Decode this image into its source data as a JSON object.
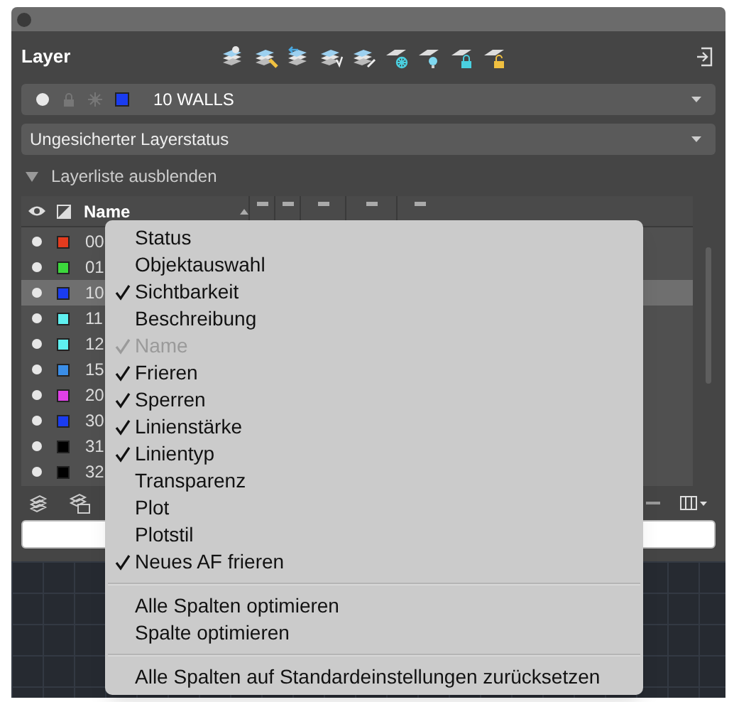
{
  "panel": {
    "title": "Layer"
  },
  "current_layer": {
    "label": "10 WALLS",
    "color": "#1a3cf0"
  },
  "layer_state": {
    "label": "Ungesicherter Layerstatus"
  },
  "collapse_toggle": {
    "label": "Layerliste ausblenden",
    "expanded": true
  },
  "table": {
    "columns": [
      {
        "label": "Name"
      }
    ],
    "rows": [
      {
        "name": "00",
        "color": "#e33b1e",
        "selected": false
      },
      {
        "name": "01",
        "color": "#3cd83c",
        "selected": false
      },
      {
        "name": "10",
        "color": "#1a3cf0",
        "selected": true
      },
      {
        "name": "11",
        "color": "#5ff0f0",
        "selected": false
      },
      {
        "name": "12",
        "color": "#5ff0f0",
        "selected": false
      },
      {
        "name": "15",
        "color": "#3a8ee8",
        "selected": false
      },
      {
        "name": "20",
        "color": "#e040e8",
        "selected": false
      },
      {
        "name": "30",
        "color": "#1a3cf0",
        "selected": false
      },
      {
        "name": "31",
        "color": "#000000",
        "selected": false
      },
      {
        "name": "32",
        "color": "#000000",
        "selected": false
      }
    ]
  },
  "context_menu": {
    "groups": [
      [
        {
          "label": "Status",
          "checked": false,
          "disabled": false
        },
        {
          "label": "Objektauswahl",
          "checked": false,
          "disabled": false
        },
        {
          "label": "Sichtbarkeit",
          "checked": true,
          "disabled": false
        },
        {
          "label": "Beschreibung",
          "checked": false,
          "disabled": false
        },
        {
          "label": "Name",
          "checked": true,
          "disabled": true
        },
        {
          "label": "Frieren",
          "checked": true,
          "disabled": false
        },
        {
          "label": "Sperren",
          "checked": true,
          "disabled": false
        },
        {
          "label": "Linienstärke",
          "checked": true,
          "disabled": false
        },
        {
          "label": "Linientyp",
          "checked": true,
          "disabled": false
        },
        {
          "label": "Transparenz",
          "checked": false,
          "disabled": false
        },
        {
          "label": "Plot",
          "checked": false,
          "disabled": false
        },
        {
          "label": "Plotstil",
          "checked": false,
          "disabled": false
        },
        {
          "label": "Neues AF frieren",
          "checked": true,
          "disabled": false
        }
      ],
      [
        {
          "label": "Alle Spalten optimieren",
          "checked": false,
          "disabled": false
        },
        {
          "label": "Spalte optimieren",
          "checked": false,
          "disabled": false
        }
      ],
      [
        {
          "label": "Alle Spalten auf Standardeinstellungen zurücksetzen",
          "checked": false,
          "disabled": false
        }
      ]
    ]
  }
}
